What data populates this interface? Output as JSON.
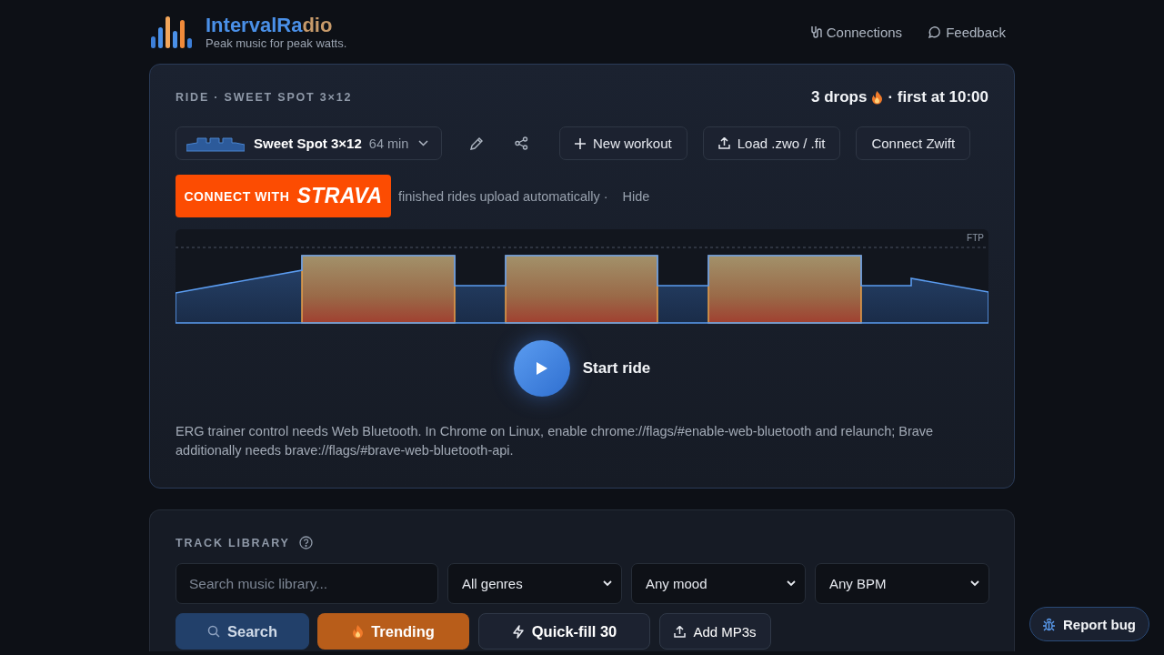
{
  "app": {
    "name_main": "IntervalRa",
    "name_accent": "dio",
    "tagline": "Peak music for peak watts."
  },
  "nav": [
    {
      "kind": "connections",
      "label": "Connections"
    },
    {
      "kind": "feedback",
      "label": "Feedback"
    }
  ],
  "ride": {
    "heading": "RIDE · SWEET SPOT 3×12",
    "drops": "3 drops",
    "drops_suffix": "· first at 10:00",
    "workout": {
      "name": "Sweet Spot 3×12",
      "duration": "64 min"
    },
    "actions": [
      {
        "kind": "new",
        "label": "New workout"
      },
      {
        "kind": "load",
        "label": "Load .zwo / .fit"
      },
      {
        "kind": "zwift",
        "label": "Connect Zwift"
      }
    ],
    "strava": {
      "prefix": "CONNECT WITH",
      "brand": "STRAVA",
      "note": "finished rides upload automatically ·",
      "hide": "Hide"
    },
    "profile": {
      "ftp_label": "FTP"
    },
    "start": {
      "label": "Start ride"
    },
    "note": "ERG trainer control needs Web Bluetooth. In Chrome on Linux, enable chrome://flags/#enable-web-bluetooth and relaunch; Brave additionally needs brave://flags/#brave-web-bluetooth-api."
  },
  "library": {
    "heading": "TRACK LIBRARY",
    "search": {
      "placeholder": "Search music library..."
    },
    "filters": [
      {
        "label": "All genres"
      },
      {
        "label": "Any mood"
      },
      {
        "label": "Any BPM"
      }
    ],
    "buttons": [
      {
        "kind": "search",
        "label": "Search",
        "disabled": true
      },
      {
        "kind": "trending",
        "label": "Trending",
        "disabled": false
      },
      {
        "kind": "quickfill",
        "label": "Quick-fill 30",
        "disabled": false
      },
      {
        "kind": "upload",
        "label": "Add MP3s",
        "disabled": false
      }
    ]
  },
  "report_bug": {
    "label": "Report bug"
  }
}
